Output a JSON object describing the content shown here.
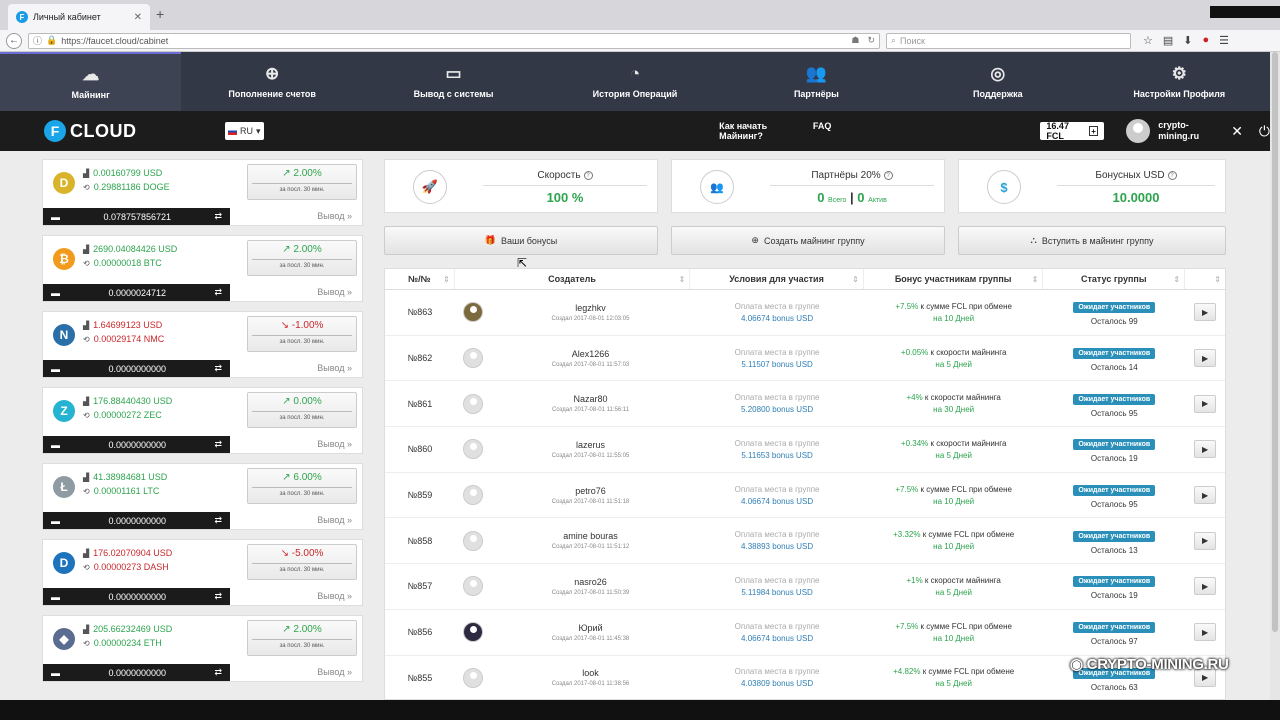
{
  "browser": {
    "tab_title": "Личный кабинет",
    "url": "https://faucet.cloud/cabinet",
    "search_placeholder": "Поиск"
  },
  "nav": [
    {
      "label": "Майнинг",
      "icon": "☁"
    },
    {
      "label": "Пополнение счетов",
      "icon": "⊕"
    },
    {
      "label": "Вывод с системы",
      "icon": "▭"
    },
    {
      "label": "История Операций",
      "icon": "◔"
    },
    {
      "label": "Партнёры",
      "icon": "👥"
    },
    {
      "label": "Поддержка",
      "icon": "◎"
    },
    {
      "label": "Настройки Профиля",
      "icon": "⚙"
    }
  ],
  "header": {
    "logo_letter": "F",
    "logo_text": "CLOUD",
    "lang": "RU",
    "link_how": "Как начать Майнинг?",
    "link_faq": "FAQ",
    "balance": "16.47 FCL",
    "user": "crypto-\nmining.ru"
  },
  "coins": [
    {
      "usd": "0.00160799 USD",
      "amt": "0.29881186 DOGE",
      "chg": "2.00%",
      "chg_sub": "за посл. 30 мин.",
      "bal": "0.078757856721",
      "out": "Вывод",
      "icon": "D",
      "color": "#d9b42a",
      "dir": "up"
    },
    {
      "usd": "2690.04084426 USD",
      "amt": "0.00000018 BTC",
      "chg": "2.00%",
      "chg_sub": "за посл. 30 мин.",
      "bal": "0.0000024712",
      "out": "Вывод",
      "icon": "₿",
      "color": "#f29a1c",
      "dir": "up"
    },
    {
      "usd": "1.64699123 USD",
      "amt": "0.00029174 NMC",
      "chg": "-1.00%",
      "chg_sub": "за посл. 30 мин.",
      "bal": "0.0000000000",
      "out": "Вывод",
      "icon": "N",
      "color": "#2a6fa7",
      "dir": "down"
    },
    {
      "usd": "176.88440430 USD",
      "amt": "0.00000272 ZEC",
      "chg": "0.00%",
      "chg_sub": "за посл. 30 мин.",
      "bal": "0.0000000000",
      "out": "Вывод",
      "icon": "Z",
      "color": "#25b3d2",
      "dir": "up"
    },
    {
      "usd": "41.38984681 USD",
      "amt": "0.00001161 LTC",
      "chg": "6.00%",
      "chg_sub": "за посл. 30 мин.",
      "bal": "0.0000000000",
      "out": "Вывод",
      "icon": "Ł",
      "color": "#8f9ba3",
      "dir": "up"
    },
    {
      "usd": "176.02070904 USD",
      "amt": "0.00000273 DASH",
      "chg": "-5.00%",
      "chg_sub": "за посл. 30 мин.",
      "bal": "0.0000000000",
      "out": "Вывод",
      "icon": "D",
      "color": "#1e73be",
      "dir": "down"
    },
    {
      "usd": "205.66232469 USD",
      "amt": "0.00000234 ETH",
      "chg": "2.00%",
      "chg_sub": "за посл. 30 мин.",
      "bal": "0.0000000000",
      "out": "Вывод",
      "icon": "◆",
      "color": "#5a6c8f",
      "dir": "up"
    }
  ],
  "stats": [
    {
      "title": "Скорость",
      "value": "100 %",
      "icon": "🚀",
      "color": "#e64a2e"
    },
    {
      "title": "Партнёры 20%",
      "v1": "0",
      "l1": "Всего",
      "v2": "0",
      "l2": "Актив",
      "icon": "👥",
      "color": "#2aa0d6"
    },
    {
      "title": "Бонусных USD",
      "value": "10.0000",
      "icon": "$",
      "color": "#2aa0d6"
    }
  ],
  "buttons": {
    "bonus": "Ваши бонусы",
    "create": "Создать майнинг группу",
    "join": "Вступить в майнинг группу"
  },
  "table": {
    "headers": [
      "№/№",
      "Создатель",
      "Условия для участия",
      "Бонус участникам группы",
      "Статус группы"
    ],
    "rows": [
      {
        "id": "№863",
        "name": "legzhkv",
        "created": "Создал 2017-08-01 12:03:05",
        "c1": "Оплата места в группе",
        "c2": "4.06674 bonus USD",
        "pct": "+7.5%",
        "b1": " к сумме FCL при обмене",
        "b2": "на 10 Дней",
        "status": "Ожидает участников",
        "left": "Осталось 99",
        "av": "pic1"
      },
      {
        "id": "№862",
        "name": "Alex1266",
        "created": "Создал 2017-08-01 11:57:03",
        "c1": "Оплата места в группе",
        "c2": "5.11507 bonus USD",
        "pct": "+0.05%",
        "b1": " к скорости майнинга",
        "b2": "на 5 Дней",
        "status": "Ожидает участников",
        "left": "Осталось 14",
        "av": ""
      },
      {
        "id": "№861",
        "name": "Nazar80",
        "created": "Создал 2017-08-01 11:56:11",
        "c1": "Оплата места в группе",
        "c2": "5.20800 bonus USD",
        "pct": "+4%",
        "b1": " к скорости майнинга",
        "b2": "на 30 Дней",
        "status": "Ожидает участников",
        "left": "Осталось 95",
        "av": ""
      },
      {
        "id": "№860",
        "name": "lazerus",
        "created": "Создал 2017-08-01 11:55:05",
        "c1": "Оплата места в группе",
        "c2": "5.11653 bonus USD",
        "pct": "+0.34%",
        "b1": " к скорости майнинга",
        "b2": "на 5 Дней",
        "status": "Ожидает участников",
        "left": "Осталось 19",
        "av": ""
      },
      {
        "id": "№859",
        "name": "petro76",
        "created": "Создал 2017-08-01 11:51:18",
        "c1": "Оплата места в группе",
        "c2": "4.06674 bonus USD",
        "pct": "+7.5%",
        "b1": " к сумме FCL при обмене",
        "b2": "на 10 Дней",
        "status": "Ожидает участников",
        "left": "Осталось 95",
        "av": ""
      },
      {
        "id": "№858",
        "name": "amine bouras",
        "created": "Создал 2017-08-01 11:51:12",
        "c1": "Оплата места в группе",
        "c2": "4.38893 bonus USD",
        "pct": "+3.32%",
        "b1": " к сумме FCL при обмене",
        "b2": "на 10 Дней",
        "status": "Ожидает участников",
        "left": "Осталось 13",
        "av": ""
      },
      {
        "id": "№857",
        "name": "nasro26",
        "created": "Создал 2017-08-01 11:50:39",
        "c1": "Оплата места в группе",
        "c2": "5.11984 bonus USD",
        "pct": "+1%",
        "b1": " к скорости майнинга",
        "b2": "на 5 Дней",
        "status": "Ожидает участников",
        "left": "Осталось 19",
        "av": ""
      },
      {
        "id": "№856",
        "name": "Юрий",
        "created": "Создал 2017-08-01 11:45:38",
        "c1": "Оплата места в группе",
        "c2": "4.06674 bonus USD",
        "pct": "+7.5%",
        "b1": " к сумме FCL при обмене",
        "b2": "на 10 Дней",
        "status": "Ожидает участников",
        "left": "Осталось 97",
        "av": "pic2"
      },
      {
        "id": "№855",
        "name": "look",
        "created": "Создал 2017-08-01 11:38:56",
        "c1": "Оплата места в группе",
        "c2": "4.03809 bonus USD",
        "pct": "+4.82%",
        "b1": " к сумме FCL при обмене",
        "b2": "на 5 Дней",
        "status": "Ожидает участников",
        "left": "Осталось 63",
        "av": ""
      }
    ]
  },
  "watermark": "CRYPTO-MINING.RU"
}
